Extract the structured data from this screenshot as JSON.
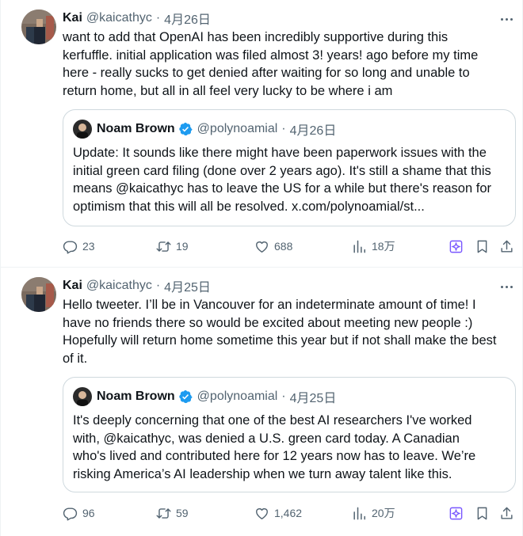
{
  "tweets": [
    {
      "author": {
        "name": "Kai",
        "handle": "@kaicathyc"
      },
      "date": "4月26日",
      "text_lines": [
        "want to add that OpenAI has been incredibly supportive during this",
        "kerfuffle. initial application was filed almost 3! years! ago  before my time",
        "here - really sucks to get denied after waiting for so long and unable to",
        "return home, but all in all feel very lucky to be where i am"
      ],
      "quote": {
        "author": {
          "name": "Noam Brown",
          "handle": "@polynoamial"
        },
        "date": "4月26日",
        "text_lines": [
          "Update: It sounds like there might have been paperwork issues with the",
          "initial green card filing (done over 2 years ago). It's still a shame that this",
          "means @kaicathyc has to leave the US for a while but there's reason for",
          "optimism that this will all be resolved. x.com/polynoamial/st..."
        ]
      },
      "stats": {
        "replies": "23",
        "retweets": "19",
        "likes": "688",
        "views": "18万"
      }
    },
    {
      "author": {
        "name": "Kai",
        "handle": "@kaicathyc"
      },
      "date": "4月25日",
      "text_lines": [
        "Hello tweeter. I’ll be in Vancouver for an indeterminate amount of time! I",
        "have no friends there so would be excited about meeting new people :)",
        "Hopefully will return home sometime this year but if not shall make the best",
        "of it."
      ],
      "quote": {
        "author": {
          "name": "Noam Brown",
          "handle": "@polynoamial"
        },
        "date": "4月25日",
        "text_lines": [
          "It's deeply concerning that one of the best AI researchers I've worked",
          "with, @kaicathyc, was denied a U.S. green card today. A Canadian",
          "who's lived and contributed here for 12 years now has to leave. We’re",
          "risking America’s AI leadership when we turn away talent like this."
        ]
      },
      "stats": {
        "replies": "96",
        "retweets": "59",
        "likes": "1,462",
        "views": "20万"
      }
    }
  ],
  "separator": "·",
  "icons": [
    "more-icon",
    "verified-badge-icon",
    "reply-icon",
    "retweet-icon",
    "like-icon",
    "views-icon",
    "grok-icon",
    "bookmark-icon",
    "share-icon"
  ],
  "colors": {
    "text": "#0f1419",
    "secondary": "#536471",
    "border": "#cfd9de",
    "divider": "#eff3f4",
    "verified": "#1d9bf0",
    "grok": "#7856ff"
  }
}
